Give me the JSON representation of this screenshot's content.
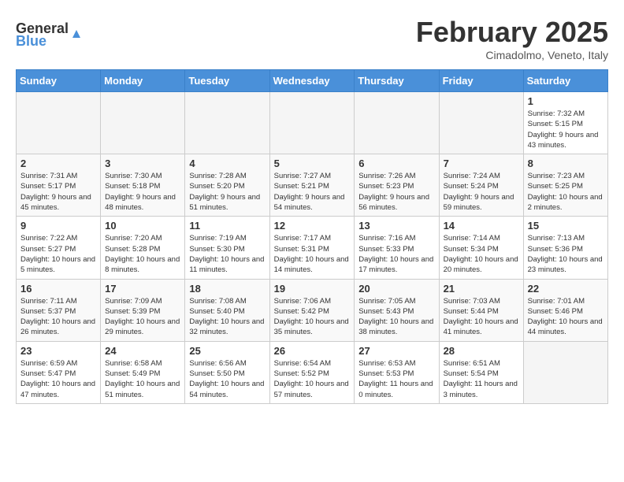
{
  "header": {
    "logo_general": "General",
    "logo_blue": "Blue",
    "month_year": "February 2025",
    "location": "Cimadolmo, Veneto, Italy"
  },
  "weekdays": [
    "Sunday",
    "Monday",
    "Tuesday",
    "Wednesday",
    "Thursday",
    "Friday",
    "Saturday"
  ],
  "weeks": [
    [
      {
        "day": "",
        "info": ""
      },
      {
        "day": "",
        "info": ""
      },
      {
        "day": "",
        "info": ""
      },
      {
        "day": "",
        "info": ""
      },
      {
        "day": "",
        "info": ""
      },
      {
        "day": "",
        "info": ""
      },
      {
        "day": "1",
        "info": "Sunrise: 7:32 AM\nSunset: 5:15 PM\nDaylight: 9 hours and 43 minutes."
      }
    ],
    [
      {
        "day": "2",
        "info": "Sunrise: 7:31 AM\nSunset: 5:17 PM\nDaylight: 9 hours and 45 minutes."
      },
      {
        "day": "3",
        "info": "Sunrise: 7:30 AM\nSunset: 5:18 PM\nDaylight: 9 hours and 48 minutes."
      },
      {
        "day": "4",
        "info": "Sunrise: 7:28 AM\nSunset: 5:20 PM\nDaylight: 9 hours and 51 minutes."
      },
      {
        "day": "5",
        "info": "Sunrise: 7:27 AM\nSunset: 5:21 PM\nDaylight: 9 hours and 54 minutes."
      },
      {
        "day": "6",
        "info": "Sunrise: 7:26 AM\nSunset: 5:23 PM\nDaylight: 9 hours and 56 minutes."
      },
      {
        "day": "7",
        "info": "Sunrise: 7:24 AM\nSunset: 5:24 PM\nDaylight: 9 hours and 59 minutes."
      },
      {
        "day": "8",
        "info": "Sunrise: 7:23 AM\nSunset: 5:25 PM\nDaylight: 10 hours and 2 minutes."
      }
    ],
    [
      {
        "day": "9",
        "info": "Sunrise: 7:22 AM\nSunset: 5:27 PM\nDaylight: 10 hours and 5 minutes."
      },
      {
        "day": "10",
        "info": "Sunrise: 7:20 AM\nSunset: 5:28 PM\nDaylight: 10 hours and 8 minutes."
      },
      {
        "day": "11",
        "info": "Sunrise: 7:19 AM\nSunset: 5:30 PM\nDaylight: 10 hours and 11 minutes."
      },
      {
        "day": "12",
        "info": "Sunrise: 7:17 AM\nSunset: 5:31 PM\nDaylight: 10 hours and 14 minutes."
      },
      {
        "day": "13",
        "info": "Sunrise: 7:16 AM\nSunset: 5:33 PM\nDaylight: 10 hours and 17 minutes."
      },
      {
        "day": "14",
        "info": "Sunrise: 7:14 AM\nSunset: 5:34 PM\nDaylight: 10 hours and 20 minutes."
      },
      {
        "day": "15",
        "info": "Sunrise: 7:13 AM\nSunset: 5:36 PM\nDaylight: 10 hours and 23 minutes."
      }
    ],
    [
      {
        "day": "16",
        "info": "Sunrise: 7:11 AM\nSunset: 5:37 PM\nDaylight: 10 hours and 26 minutes."
      },
      {
        "day": "17",
        "info": "Sunrise: 7:09 AM\nSunset: 5:39 PM\nDaylight: 10 hours and 29 minutes."
      },
      {
        "day": "18",
        "info": "Sunrise: 7:08 AM\nSunset: 5:40 PM\nDaylight: 10 hours and 32 minutes."
      },
      {
        "day": "19",
        "info": "Sunrise: 7:06 AM\nSunset: 5:42 PM\nDaylight: 10 hours and 35 minutes."
      },
      {
        "day": "20",
        "info": "Sunrise: 7:05 AM\nSunset: 5:43 PM\nDaylight: 10 hours and 38 minutes."
      },
      {
        "day": "21",
        "info": "Sunrise: 7:03 AM\nSunset: 5:44 PM\nDaylight: 10 hours and 41 minutes."
      },
      {
        "day": "22",
        "info": "Sunrise: 7:01 AM\nSunset: 5:46 PM\nDaylight: 10 hours and 44 minutes."
      }
    ],
    [
      {
        "day": "23",
        "info": "Sunrise: 6:59 AM\nSunset: 5:47 PM\nDaylight: 10 hours and 47 minutes."
      },
      {
        "day": "24",
        "info": "Sunrise: 6:58 AM\nSunset: 5:49 PM\nDaylight: 10 hours and 51 minutes."
      },
      {
        "day": "25",
        "info": "Sunrise: 6:56 AM\nSunset: 5:50 PM\nDaylight: 10 hours and 54 minutes."
      },
      {
        "day": "26",
        "info": "Sunrise: 6:54 AM\nSunset: 5:52 PM\nDaylight: 10 hours and 57 minutes."
      },
      {
        "day": "27",
        "info": "Sunrise: 6:53 AM\nSunset: 5:53 PM\nDaylight: 11 hours and 0 minutes."
      },
      {
        "day": "28",
        "info": "Sunrise: 6:51 AM\nSunset: 5:54 PM\nDaylight: 11 hours and 3 minutes."
      },
      {
        "day": "",
        "info": ""
      }
    ]
  ]
}
